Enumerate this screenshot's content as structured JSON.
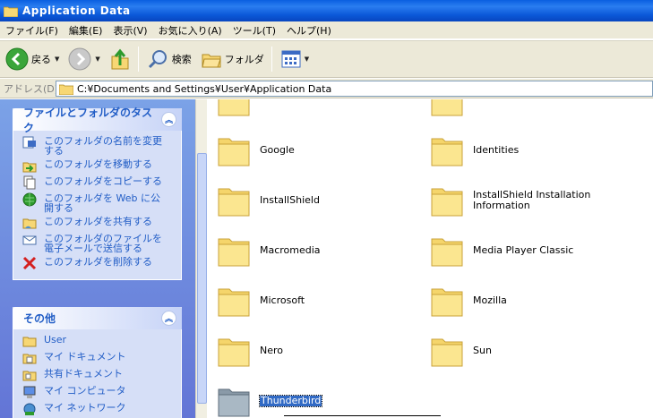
{
  "window": {
    "title": "Application Data"
  },
  "menu": [
    "ファイル(F)",
    "編集(E)",
    "表示(V)",
    "お気に入り(A)",
    "ツール(T)",
    "ヘルプ(H)"
  ],
  "toolbar": {
    "back": "戻る",
    "search": "検索",
    "folders": "フォルダ"
  },
  "address": {
    "label": "アドレス(D)",
    "path": "C:¥Documents and Settings¥User¥Application Data"
  },
  "tasks": {
    "title": "ファイルとフォルダのタスク",
    "items": [
      {
        "label": "このフォルダの名前を変更する",
        "icon": "rename-icon"
      },
      {
        "label": "このフォルダを移動する",
        "icon": "move-icon"
      },
      {
        "label": "このフォルダをコピーする",
        "icon": "copy-icon"
      },
      {
        "label": "このフォルダを Web に公開する",
        "icon": "publish-icon"
      },
      {
        "label": "このフォルダを共有する",
        "icon": "share-icon"
      },
      {
        "label": "このフォルダのファイルを電子メールで送信する",
        "icon": "email-icon"
      },
      {
        "label": "このフォルダを削除する",
        "icon": "delete-icon"
      }
    ]
  },
  "other": {
    "title": "その他",
    "items": [
      {
        "label": "User",
        "icon": "folder-icon"
      },
      {
        "label": "マイ ドキュメント",
        "icon": "my-documents-icon"
      },
      {
        "label": "共有ドキュメント",
        "icon": "shared-documents-icon"
      },
      {
        "label": "マイ コンピュータ",
        "icon": "my-computer-icon"
      },
      {
        "label": "マイ ネットワーク",
        "icon": "my-network-icon"
      }
    ]
  },
  "folders": [
    {
      "name": "",
      "col": 0
    },
    {
      "name": "",
      "col": 1
    },
    {
      "name": "Google",
      "col": 0
    },
    {
      "name": "Identities",
      "col": 1
    },
    {
      "name": "InstallShield",
      "col": 0
    },
    {
      "name": "InstallShield Installation Information",
      "col": 1
    },
    {
      "name": "Macromedia",
      "col": 0
    },
    {
      "name": "Media Player Classic",
      "col": 1
    },
    {
      "name": "Microsoft",
      "col": 0
    },
    {
      "name": "Mozilla",
      "col": 1
    },
    {
      "name": "Nero",
      "col": 0
    },
    {
      "name": "Sun",
      "col": 1
    },
    {
      "name": "Thunderbird",
      "col": 0,
      "selected": true
    }
  ],
  "colors": {
    "titlebar": "#0a5fe0",
    "link": "#215dc6",
    "selection": "#316ac5"
  }
}
